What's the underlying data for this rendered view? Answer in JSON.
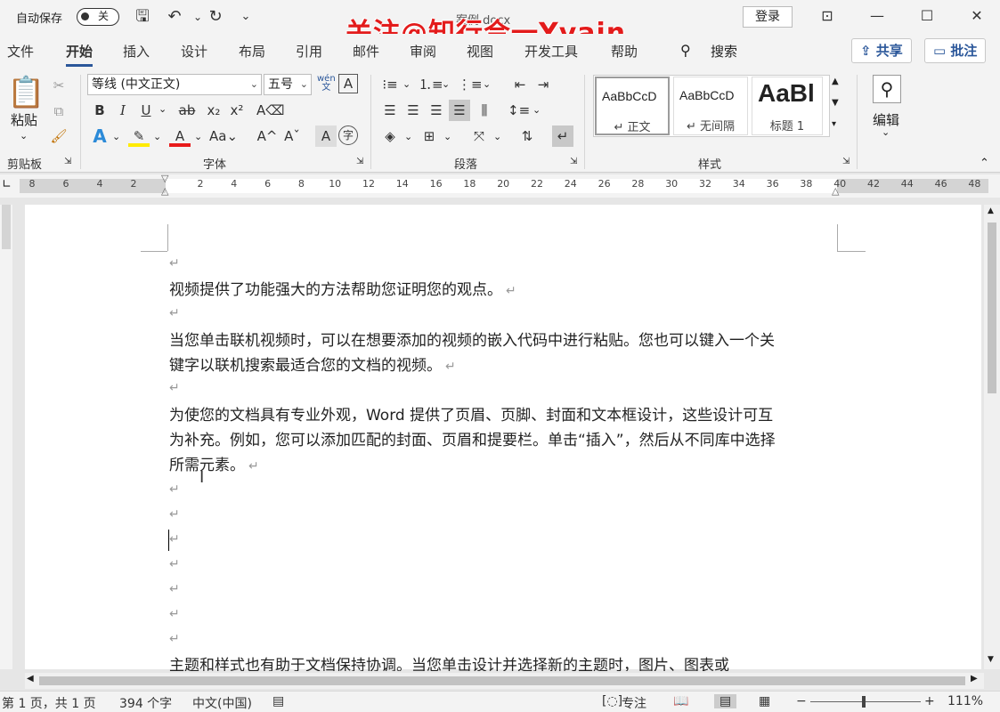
{
  "titlebar": {
    "autosave_label": "自动保存",
    "autosave_state": "关",
    "doc_title": "案例.docx",
    "watermark": "关注@知行合一Yvain",
    "login_label": "登录"
  },
  "tabs": [
    "文件",
    "开始",
    "插入",
    "设计",
    "布局",
    "引用",
    "邮件",
    "审阅",
    "视图",
    "开发工具",
    "帮助"
  ],
  "search_label": "搜索",
  "share_label": "共享",
  "comment_label": "批注",
  "clipboard": {
    "paste_label": "粘贴",
    "group_label": "剪贴板"
  },
  "font": {
    "family": "等线 (中文正文)",
    "size": "五号",
    "group_label": "字体",
    "wen_label": "wén\n文",
    "bold": "B",
    "italic": "I",
    "underline": "U",
    "strike": "ab",
    "sub": "x₂",
    "sup": "x²"
  },
  "paragraph": {
    "group_label": "段落"
  },
  "styles": {
    "group_label": "样式",
    "items": [
      {
        "preview": "AaBbCcD",
        "name": "↵ 正文"
      },
      {
        "preview": "AaBbCcD",
        "name": "↵ 无间隔"
      },
      {
        "preview": "AaBl",
        "name": "标题 1"
      }
    ]
  },
  "editing": {
    "label": "编辑"
  },
  "ruler_ticks": [
    "8",
    "6",
    "4",
    "2",
    "2",
    "4",
    "6",
    "8",
    "10",
    "12",
    "14",
    "16",
    "18",
    "20",
    "22",
    "24",
    "26",
    "28",
    "30",
    "32",
    "34",
    "36",
    "38",
    "40",
    "42",
    "44",
    "46",
    "48"
  ],
  "document": {
    "paragraphs": [
      "视频提供了功能强大的方法帮助您证明您的观点。",
      "当您单击联机视频时，可以在想要添加的视频的嵌入代码中进行粘贴。您也可以键入一个关",
      "键字以联机搜索最适合您的文档的视频。",
      "为使您的文档具有专业外观，Word 提供了页眉、页脚、封面和文本框设计，这些设计可互",
      "为补充。例如，您可以添加匹配的封面、页眉和提要栏。单击“插入”，然后从不同库中选择",
      "所需元素。",
      "主题和样式也有助于文档保持协调。当您单击设计并选择新的主题时，图片、图表或"
    ],
    "pilcrow": "↵"
  },
  "status": {
    "page": "第 1 页，共 1 页",
    "words": "394 个字",
    "lang": "中文(中国)",
    "focus": "专注",
    "zoom": "111%"
  }
}
